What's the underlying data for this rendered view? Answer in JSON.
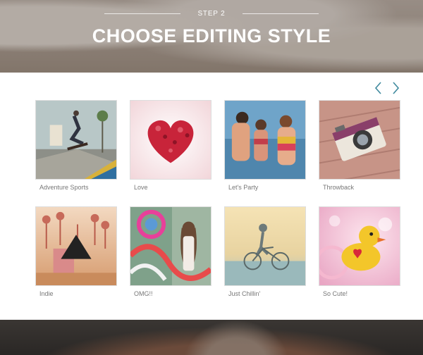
{
  "header": {
    "step_label": "STEP 2",
    "title": "CHOOSE EDITING STYLE"
  },
  "nav": {
    "prev_icon": "chevron-left-icon",
    "next_icon": "chevron-right-icon",
    "accent_color": "#3f8a9e"
  },
  "styles": [
    {
      "label": "Adventure Sports"
    },
    {
      "label": "Love"
    },
    {
      "label": "Let's Party"
    },
    {
      "label": "Throwback"
    },
    {
      "label": "Indie"
    },
    {
      "label": "OMG!!"
    },
    {
      "label": "Just Chillin'"
    },
    {
      "label": "So Cute!"
    }
  ]
}
